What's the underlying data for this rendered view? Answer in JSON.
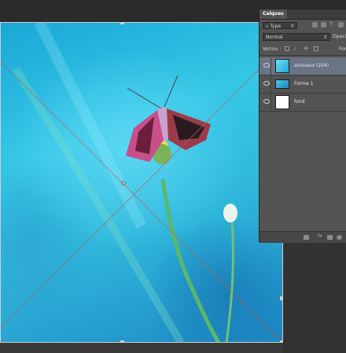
{
  "panel": {
    "tab_label": "Calques",
    "filter_label": "Type",
    "blend_mode": "Normal",
    "opacity_label": "Opacité",
    "lock_label": "Verrou :",
    "fill_label": "Fond"
  },
  "layers": [
    {
      "name": "animaux (204)",
      "selected": true,
      "thumb": "photo"
    },
    {
      "name": "Forme 1",
      "selected": false,
      "thumb": "shape"
    },
    {
      "name": "fond",
      "selected": false,
      "thumb": "white"
    }
  ],
  "icons": {
    "filter": "search-icon",
    "eye": "eye-icon",
    "link": "link-icon",
    "fx": "fx-icon",
    "mask": "mask-icon",
    "adjust": "adjustment-icon",
    "folder": "folder-icon",
    "new": "new-layer-icon",
    "trash": "trash-icon"
  },
  "colors": {
    "panel_bg": "#535353",
    "selected_layer": "#6a7485",
    "canvas_primary": "#2fb8dc"
  },
  "footer": {
    "fx_label": "fx"
  }
}
